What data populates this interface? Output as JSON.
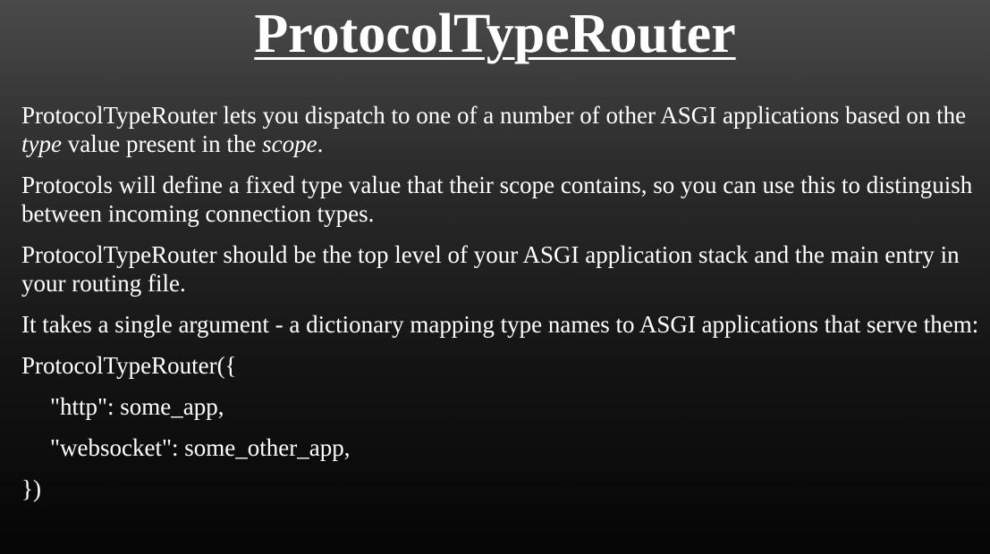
{
  "slide": {
    "title": "ProtocolTypeRouter",
    "paragraphs": [
      {
        "p1_part1": "ProtocolTypeRouter lets you dispatch to one of a number of other ASGI applications based on the ",
        "p1_em1": "type",
        "p1_part2": " value present in the ",
        "p1_em2": "scope",
        "p1_part3": "."
      },
      {
        "text": "Protocols will define a fixed type value that their scope contains, so you can use this to distinguish between incoming connection types."
      },
      {
        "text": "ProtocolTypeRouter should be the top level of your ASGI application stack and the main entry in your routing file."
      },
      {
        "text": "It takes a single argument - a dictionary mapping type names to ASGI applications that serve them:"
      }
    ],
    "code": [
      "ProtocolTypeRouter({",
      "\"http\": some_app,",
      "\"websocket\": some_other_app,",
      "})"
    ]
  }
}
